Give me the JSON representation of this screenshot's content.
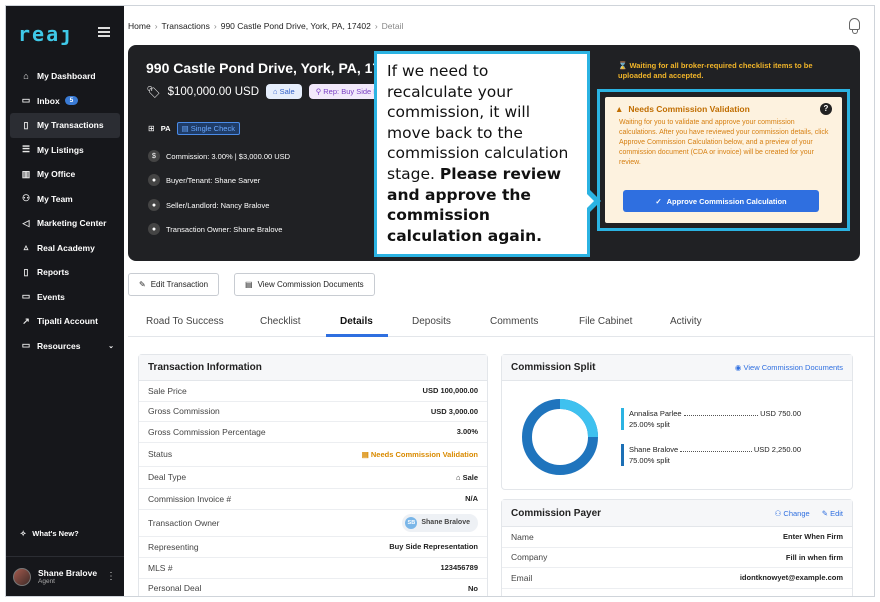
{
  "sidebar": {
    "logo": "reaȷ",
    "items": [
      {
        "label": "My Dashboard",
        "icon": "home-icon",
        "glyph": "⌂"
      },
      {
        "label": "Inbox",
        "icon": "inbox-icon",
        "glyph": "▭",
        "badge": "5"
      },
      {
        "label": "My Transactions",
        "icon": "transactions-icon",
        "glyph": "▯"
      },
      {
        "label": "My Listings",
        "icon": "listings-icon",
        "glyph": "☰"
      },
      {
        "label": "My Office",
        "icon": "office-icon",
        "glyph": "▥"
      },
      {
        "label": "My Team",
        "icon": "team-icon",
        "glyph": "⚇"
      },
      {
        "label": "Marketing Center",
        "icon": "megaphone-icon",
        "glyph": "◁"
      },
      {
        "label": "Real Academy",
        "icon": "academy-icon",
        "glyph": "▵"
      },
      {
        "label": "Reports",
        "icon": "reports-icon",
        "glyph": "▯"
      },
      {
        "label": "Events",
        "icon": "calendar-icon",
        "glyph": "▭"
      },
      {
        "label": "Tipalti Account",
        "icon": "external-link-icon",
        "glyph": "↗"
      },
      {
        "label": "Resources",
        "icon": "resources-icon",
        "glyph": "▭",
        "chevron": "⌄"
      }
    ],
    "whats_new": "What's New?",
    "user": {
      "name": "Shane Bralove",
      "role": "Agent"
    }
  },
  "breadcrumb": [
    "Home",
    "Transactions",
    "990 Castle Pond Drive, York, PA, 17402",
    "Detail"
  ],
  "hero": {
    "title": "990 Castle Pond Drive, York, PA, 17402",
    "price": "$100,000.00 USD",
    "pill_sale": "Sale",
    "pill_rep": "Rep: Buy Side R",
    "state": "PA",
    "single_check": "Single Check",
    "commission": "Commission: 3.00% | $3,000.00 USD",
    "buyer": "Buyer/Tenant: Shane Sarver",
    "seller": "Seller/Landlord: Nancy Bralove",
    "owner": "Transaction Owner: Shane Bralove",
    "warning": "Waiting for all broker-required checklist items to be uploaded and accepted.",
    "validation": {
      "title": "Needs Commission Validation",
      "body": "Waiting for you to validate and approve your commission calculations. After you have reviewed your commission details, click Approve Commission Calculation below, and a preview of your commission document (CDA or invoice) will be created for your review.",
      "button": "Approve Commission Calculation"
    }
  },
  "callout": {
    "text": "If we need to recalculate your commission, it will move back to the commission calculation stage.",
    "bold": "Please review and approve the commission calculation again."
  },
  "actions": {
    "edit": "Edit Transaction",
    "view_docs": "View Commission Documents"
  },
  "tabs": [
    "Road To Success",
    "Checklist",
    "Details",
    "Deposits",
    "Comments",
    "File Cabinet",
    "Activity"
  ],
  "transaction_info": {
    "title": "Transaction Information",
    "rows": [
      {
        "label": "Sale Price",
        "value": "USD 100,000.00"
      },
      {
        "label": "Gross Commission",
        "value": "USD 3,000.00"
      },
      {
        "label": "Gross Commission Percentage",
        "value": "3.00%"
      },
      {
        "label": "Status",
        "value": "Needs Commission Validation"
      },
      {
        "label": "Deal Type",
        "value": "Sale"
      },
      {
        "label": "Commission Invoice #",
        "value": "N/A"
      },
      {
        "label": "Transaction Owner",
        "value": "Shane Bralove",
        "initials": "SB"
      },
      {
        "label": "Representing",
        "value": "Buy Side Representation"
      },
      {
        "label": "MLS #",
        "value": "123456789"
      },
      {
        "label": "Personal Deal",
        "value": "No"
      }
    ]
  },
  "commission_split": {
    "title": "Commission Split",
    "link": "View Commission Documents",
    "items": [
      {
        "name": "Annalisa Parlee",
        "amount": "USD 750.00",
        "split": "25.00% split",
        "pct": 25
      },
      {
        "name": "Shane Bralove",
        "amount": "USD 2,250.00",
        "split": "75.00% split",
        "pct": 75
      }
    ],
    "colors": {
      "first": "#3fc1ef",
      "second": "#1f74bd"
    }
  },
  "commission_payer": {
    "title": "Commission Payer",
    "change": "Change",
    "edit": "Edit",
    "rows": [
      {
        "label": "Name",
        "value": "Enter When Firm"
      },
      {
        "label": "Company",
        "value": "Fill in when firm"
      },
      {
        "label": "Email",
        "value": "idontknowyet@example.com"
      }
    ]
  }
}
